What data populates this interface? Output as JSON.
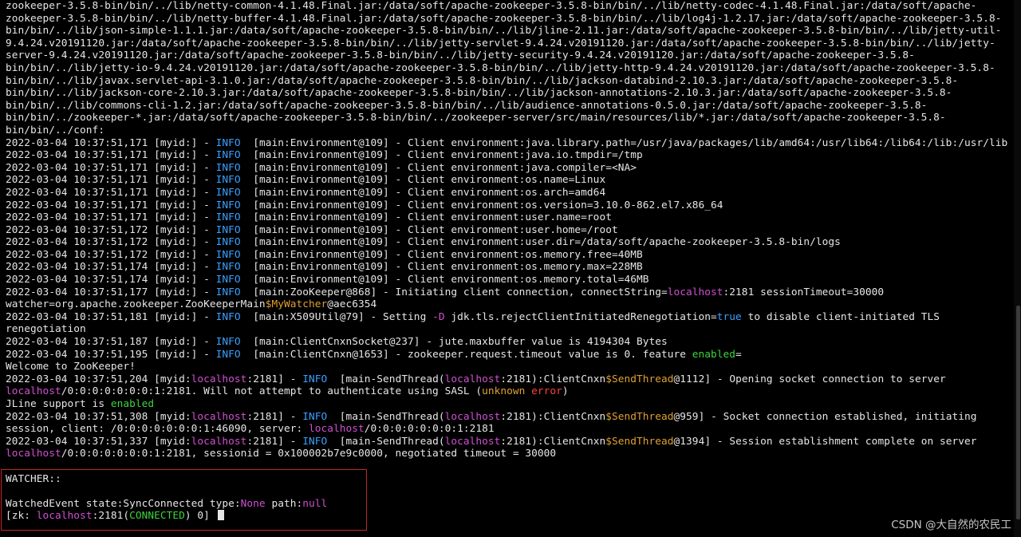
{
  "terminal": {
    "lines": [
      [
        [
          "zookeeper-3.5.8-bin/bin/../lib/netty-common-4.1.48.Final.jar:/data/soft/apache-zookeeper-3.5.8-bin/bin/../lib/netty-codec-4.1.48.Final.jar:/data/soft/apache-zookeeper-3.5.8-bin/bin/../lib/netty-buffer-4.1.48.Final.jar:/data/soft/apache-zookeeper-3.5.8-bin/bin/../lib/log4j-1.2.17.jar:/data/soft/apache-zookeeper-3.5.8-bin/bin/../lib/json-simple-1.1.1.jar:/data/soft/apache-zookeeper-3.5.8-bin/bin/../lib/jline-2.11.jar:/data/soft/apache-zookeeper-3.5.8-bin/bin/../lib/jetty-util-9.4.24.v20191120.jar:/data/soft/apache-zookeeper-3.5.8-bin/bin/../lib/jetty-servlet-9.4.24.v20191120.jar:/data/soft/apache-zookeeper-3.5.8-bin/bin/../lib/jetty-server-9.4.24.v20191120.jar:/data/soft/apache-zookeeper-3.5.8-bin/bin/../lib/jetty-security-9.4.24.v20191120.jar:/data/soft/apache-zookeeper-3.5.8-bin/bin/../lib/jetty-io-9.4.24.v20191120.jar:/data/soft/apache-zookeeper-3.5.8-bin/bin/../lib/jetty-http-9.4.24.v20191120.jar:/data/soft/apache-zookeeper-3.5.8-bin/bin/../lib/javax.servlet-api-3.1.0.jar:/data/soft/apache-zookeeper-3.5.8-bin/bin/../lib/jackson-databind-2.10.3.jar:/data/soft/apache-zookeeper-3.5.8-bin/bin/../lib/jackson-core-2.10.3.jar:/data/soft/apache-zookeeper-3.5.8-bin/bin/../lib/jackson-annotations-2.10.3.jar:/data/soft/apache-zookeeper-3.5.8-bin/bin/../lib/commons-cli-1.2.jar:/data/soft/apache-zookeeper-3.5.8-bin/bin/../lib/audience-annotations-0.5.0.jar:/data/soft/apache-zookeeper-3.5.8-bin/bin/../zookeeper-*.jar:/data/soft/apache-zookeeper-3.5.8-bin/bin/../zookeeper-server/src/main/resources/lib/*.jar:/data/soft/apache-zookeeper-3.5.8-bin/bin/../conf:",
          ""
        ]
      ],
      [
        [
          "2022-03-04 10:37:51,171 [myid:] - ",
          ""
        ],
        [
          "INFO",
          "blue"
        ],
        [
          "  [main:Environment@109] - Client environment:java.library.path=/usr/java/packages/lib/amd64:/usr/lib64:/lib64:/lib:/usr/lib",
          ""
        ]
      ],
      [
        [
          "2022-03-04 10:37:51,171 [myid:] - ",
          ""
        ],
        [
          "INFO",
          "blue"
        ],
        [
          "  [main:Environment@109] - Client environment:java.io.tmpdir=/tmp",
          ""
        ]
      ],
      [
        [
          "2022-03-04 10:37:51,171 [myid:] - ",
          ""
        ],
        [
          "INFO",
          "blue"
        ],
        [
          "  [main:Environment@109] - Client environment:java.compiler=<NA>",
          ""
        ]
      ],
      [
        [
          "2022-03-04 10:37:51,171 [myid:] - ",
          ""
        ],
        [
          "INFO",
          "blue"
        ],
        [
          "  [main:Environment@109] - Client environment:os.name=Linux",
          ""
        ]
      ],
      [
        [
          "2022-03-04 10:37:51,171 [myid:] - ",
          ""
        ],
        [
          "INFO",
          "blue"
        ],
        [
          "  [main:Environment@109] - Client environment:os.arch=amd64",
          ""
        ]
      ],
      [
        [
          "2022-03-04 10:37:51,171 [myid:] - ",
          ""
        ],
        [
          "INFO",
          "blue"
        ],
        [
          "  [main:Environment@109] - Client environment:os.version=3.10.0-862.el7.x86_64",
          ""
        ]
      ],
      [
        [
          "2022-03-04 10:37:51,171 [myid:] - ",
          ""
        ],
        [
          "INFO",
          "blue"
        ],
        [
          "  [main:Environment@109] - Client environment:user.name=root",
          ""
        ]
      ],
      [
        [
          "2022-03-04 10:37:51,172 [myid:] - ",
          ""
        ],
        [
          "INFO",
          "blue"
        ],
        [
          "  [main:Environment@109] - Client environment:user.home=/root",
          ""
        ]
      ],
      [
        [
          "2022-03-04 10:37:51,172 [myid:] - ",
          ""
        ],
        [
          "INFO",
          "blue"
        ],
        [
          "  [main:Environment@109] - Client environment:user.dir=/data/soft/apache-zookeeper-3.5.8-bin/logs",
          ""
        ]
      ],
      [
        [
          "2022-03-04 10:37:51,172 [myid:] - ",
          ""
        ],
        [
          "INFO",
          "blue"
        ],
        [
          "  [main:Environment@109] - Client environment:os.memory.free=40MB",
          ""
        ]
      ],
      [
        [
          "2022-03-04 10:37:51,174 [myid:] - ",
          ""
        ],
        [
          "INFO",
          "blue"
        ],
        [
          "  [main:Environment@109] - Client environment:os.memory.max=228MB",
          ""
        ]
      ],
      [
        [
          "2022-03-04 10:37:51,174 [myid:] - ",
          ""
        ],
        [
          "INFO",
          "blue"
        ],
        [
          "  [main:Environment@109] - Client environment:os.memory.total=46MB",
          ""
        ]
      ],
      [
        [
          "2022-03-04 10:37:51,177 [myid:] - ",
          ""
        ],
        [
          "INFO",
          "blue"
        ],
        [
          "  [main:ZooKeeper@868] - Initiating client connection, connectString=",
          ""
        ],
        [
          "localhost",
          "mag"
        ],
        [
          ":2181 sessionTimeout=30000 watcher=org.apache.zookeeper.ZooKeeperMain",
          ""
        ],
        [
          "$MyWatcher",
          "org"
        ],
        [
          "@aec6354",
          ""
        ]
      ],
      [
        [
          "2022-03-04 10:37:51,181 [myid:] - ",
          ""
        ],
        [
          "INFO",
          "blue"
        ],
        [
          "  [main:X509Util@79] - Setting ",
          ""
        ],
        [
          "-D",
          "mag"
        ],
        [
          " jdk.tls.rejectClientInitiatedRenegotiation=",
          ""
        ],
        [
          "true",
          "blue"
        ],
        [
          " to disable client-initiated TLS renegotiation",
          ""
        ]
      ],
      [
        [
          "2022-03-04 10:37:51,187 [myid:] - ",
          ""
        ],
        [
          "INFO",
          "blue"
        ],
        [
          "  [main:ClientCnxnSocket@237] - jute.maxbuffer value is 4194304 Bytes",
          ""
        ]
      ],
      [
        [
          "2022-03-04 10:37:51,195 [myid:] - ",
          ""
        ],
        [
          "INFO",
          "blue"
        ],
        [
          "  [main:ClientCnxn@1653] - zookeeper.request.timeout value is 0. feature ",
          ""
        ],
        [
          "enabled",
          "grn"
        ],
        [
          "=",
          ""
        ]
      ],
      [
        [
          "Welcome to ZooKeeper!",
          ""
        ]
      ],
      [
        [
          "2022-03-04 10:37:51,204 [myid:",
          ""
        ],
        [
          "localhost",
          "mag"
        ],
        [
          ":2181] - ",
          ""
        ],
        [
          "INFO",
          "blue"
        ],
        [
          "  [main-SendThread(",
          ""
        ],
        [
          "localhost",
          "mag"
        ],
        [
          ":2181):ClientCnxn",
          ""
        ],
        [
          "$SendThread",
          "org"
        ],
        [
          "@1112] - Opening socket connection to server ",
          ""
        ],
        [
          "localhost",
          "mag"
        ],
        [
          "/0:0:0:0:0:0:0:1:2181. Will not attempt to authenticate using SASL (",
          ""
        ],
        [
          "unknown",
          "org"
        ],
        [
          " ",
          ""
        ],
        [
          "error",
          "red"
        ],
        [
          ")",
          ""
        ]
      ],
      [
        [
          "JLine support is ",
          ""
        ],
        [
          "enabled",
          "grn"
        ]
      ],
      [
        [
          "2022-03-04 10:37:51,308 [myid:",
          ""
        ],
        [
          "localhost",
          "mag"
        ],
        [
          ":2181] - ",
          ""
        ],
        [
          "INFO",
          "blue"
        ],
        [
          "  [main-SendThread(",
          ""
        ],
        [
          "localhost",
          "mag"
        ],
        [
          ":2181):ClientCnxn",
          ""
        ],
        [
          "$SendThread",
          "org"
        ],
        [
          "@959] - Socket connection established, initiating session, client: /0:0:0:0:0:0:0:1:46090, server: ",
          ""
        ],
        [
          "localhost",
          "mag"
        ],
        [
          "/0:0:0:0:0:0:0:1:2181",
          ""
        ]
      ],
      [
        [
          "2022-03-04 10:37:51,337 [myid:",
          ""
        ],
        [
          "localhost",
          "mag"
        ],
        [
          ":2181] - ",
          ""
        ],
        [
          "INFO",
          "blue"
        ],
        [
          "  [main-SendThread(",
          ""
        ],
        [
          "localhost",
          "mag"
        ],
        [
          ":2181):ClientCnxn",
          ""
        ],
        [
          "$SendThread",
          "org"
        ],
        [
          "@1394] - Session establishment complete on server ",
          ""
        ],
        [
          "localhost",
          "mag"
        ],
        [
          "/0:0:0:0:0:0:0:1:2181, sessionid = 0x100002b7e9c0000, negotiated timeout = 30000",
          ""
        ]
      ],
      [
        [
          "",
          ""
        ]
      ],
      [
        [
          "WATCHER::",
          ""
        ]
      ],
      [
        [
          "",
          ""
        ]
      ],
      [
        [
          "WatchedEvent state:SyncConnected type:",
          ""
        ],
        [
          "None",
          "mag"
        ],
        [
          " path:",
          ""
        ],
        [
          "null",
          "mag"
        ]
      ]
    ],
    "prompt": [
      [
        "[zk: ",
        ""
      ],
      [
        "localhost",
        "mag"
      ],
      [
        ":2181(",
        ""
      ],
      [
        "CONNECTED",
        "grn"
      ],
      [
        ") 0] ",
        ""
      ]
    ]
  },
  "watermark": "CSDN @大自然的农民工",
  "colors": {
    "background": "#000000",
    "text": "#e6e6e6",
    "info_blue": "#3aa0ff",
    "keyword_magenta": "#d050d0",
    "enabled_green": "#3cd43c",
    "class_orange": "#e0a030",
    "highlight_box": "#c0272d"
  }
}
